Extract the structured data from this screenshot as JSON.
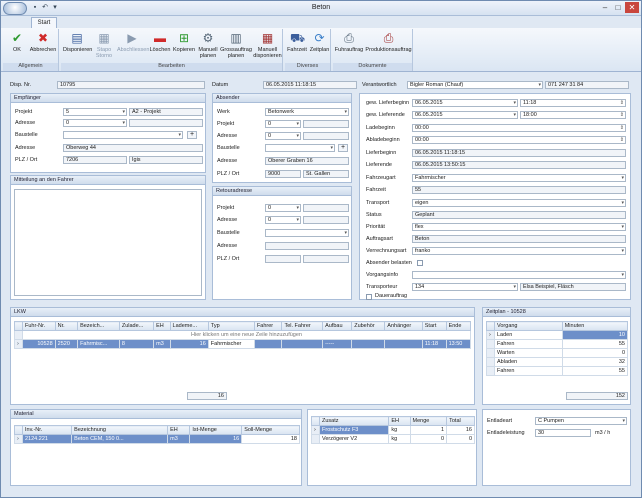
{
  "window": {
    "title": "Beton"
  },
  "tabs": [
    {
      "label": "Start"
    }
  ],
  "ribbon": {
    "allgemein": {
      "label": "Allgemein",
      "ok": "OK",
      "abbrechen": "Abbrechen"
    },
    "bearbeiten": {
      "label": "Bearbeiten",
      "disponieren": "Disponieren",
      "stapo1": "Stapo",
      "stapo2": "Storno",
      "abschliessen": "Abschliessen",
      "loeschen": "Löschen",
      "kopieren": "Kopieren",
      "manuell1": "Manuell",
      "manuell2": "planen",
      "gross1": "Grossauftrag",
      "gross2": "planen",
      "mdisp1": "Manuell",
      "mdisp2": "disponieren"
    },
    "diverses": {
      "label": "Diverses",
      "fahrzeit": "Fahrzeit",
      "zeitplan": "Zeitplan"
    },
    "dokumente": {
      "label": "Dokumente",
      "fuhrauftrag": "Fuhrauftrag",
      "produktion": "Produktionsauftrag"
    }
  },
  "header": {
    "dispnr_label": "Disp. Nr.",
    "dispnr": "10795",
    "datum_label": "Datum",
    "datum": "06.05.2015 11:18:15",
    "verantwortlich_label": "Verantwortlich",
    "verantwortlich": "Bigler Roman (Chauf)",
    "telefon": "071 247 31 84"
  },
  "empfaenger": {
    "title": "Empfänger",
    "projekt_label": "Projekt",
    "projekt": "5",
    "projekt_name": "A2 - Projekt",
    "adresse_label": "Adresse",
    "adresse_nr": "0",
    "baustelle_label": "Baustelle",
    "adresse2_label": "Adresse",
    "adresse2": "Oberweg 44",
    "plz_label": "PLZ / Ort",
    "plz": "7206",
    "ort": "Igis"
  },
  "mitteilung": {
    "title": "Mitteilung an den Fahrer"
  },
  "absender": {
    "title": "Absender",
    "werk_label": "Werk",
    "werk": "Betonwerk",
    "projekt_label": "Projekt",
    "projekt": "0",
    "adresse_label": "Adresse",
    "adresse_nr": "0",
    "baustelle_label": "Baustelle",
    "adresse2_label": "Adresse",
    "adresse2": "Oberer Graben 16",
    "plz_label": "PLZ / Ort",
    "plz": "9000",
    "ort": "St. Gallen"
  },
  "retour": {
    "title": "Retouradresse",
    "projekt_label": "Projekt",
    "projekt": "0",
    "adresse_label": "Adresse",
    "adresse_nr": "0",
    "baustelle_label": "Baustelle",
    "adresse2_label": "Adresse",
    "plz_label": "PLZ / Ort"
  },
  "details": {
    "lb_label": "gew. Lieferbeginn",
    "lb_date": "06.05.2015",
    "lb_time": "11:18",
    "le_label": "gew. Lieferende",
    "le_date": "06.05.2015",
    "le_time": "18:00",
    "ladebeginn_label": "Ladebeginn",
    "ladebeginn": "00:00",
    "abladebeginn_label": "Abladebeginn",
    "abladebeginn": "00:00",
    "lieferbeginn_label": "Lieferbeginn",
    "lieferbeginn": "06.05.2015 11:18:15",
    "lieferende_label": "Lieferende",
    "lieferende": "06.05.2015 13:50:15",
    "fahrzeugart_label": "Fahrzeugart",
    "fahrzeugart": "Fahrmischer",
    "fahrzeit_label": "Fahrzeit",
    "fahrzeit": "55",
    "transport_label": "Transport",
    "transport": "eigen",
    "status_label": "Status",
    "status": "Geplant",
    "prioritaet_label": "Priorität",
    "prioritaet": "flex",
    "auftragsart_label": "Auftragsart",
    "auftragsart": "Beton",
    "verrechnungsart_label": "Verrechnungsart",
    "verrechnungsart": "franko",
    "absender_belasten_label": "Absender belasten",
    "vorgangsinfo_label": "Vorgangsinfo",
    "transporteur_label": "Transporteur",
    "transporteur": "134",
    "transporteur_name": "Elsa Beispiel, Fläsch",
    "dauerauftrag_label": "Dauerauftrag"
  },
  "lkw": {
    "title": "LKW",
    "columns": [
      "Fuhr-Nr.",
      "Nr.",
      "Bezeich...",
      "Zulade...",
      "EH",
      "Lademe...",
      "Typ",
      "Fahrer",
      "Tel. Fahrer",
      "Aufbau",
      "Zubehör",
      "Anhänger",
      "Start",
      "Ende"
    ],
    "new_row": "Hier klicken um eine neue Zeile hinzuzufügen",
    "rows": [
      [
        "10528",
        "2520",
        "Fahrmisc...",
        "8",
        "m3",
        "16",
        "Fahrmischer",
        "",
        "",
        "-----",
        "",
        "",
        "11:18",
        "13:50"
      ]
    ],
    "total": "16"
  },
  "zeitplan": {
    "title": "Zeitplan - 10528",
    "columns": [
      "Vorgang",
      "Minuten"
    ],
    "rows": [
      [
        "Laden",
        "10"
      ],
      [
        "Fahren",
        "55"
      ],
      [
        "Warten",
        "0"
      ],
      [
        "Abladen",
        "32"
      ],
      [
        "Fahren",
        "55"
      ]
    ],
    "total": "152"
  },
  "material": {
    "title": "Material",
    "columns": [
      "Inv.-Nr.",
      "Bezeichnung",
      "EH",
      "Ist-Menge",
      "Soll-Menge"
    ],
    "rows": [
      [
        "2124.221",
        "Beton CEM, 150 0...",
        "m3",
        "16",
        "18"
      ]
    ]
  },
  "zusatz": {
    "columns": [
      "Zusatz",
      "EH",
      "Menge",
      "Total"
    ],
    "rows": [
      [
        "Frostschutz F3",
        "kg",
        "1",
        "16"
      ],
      [
        "Verzögerer V2",
        "kg",
        "0",
        "0"
      ]
    ]
  },
  "entlade": {
    "art_label": "Entladeart",
    "art": "C Pumpen",
    "leistung_label": "Entladeleistung",
    "leistung": "30",
    "einheit": "m3 / h"
  }
}
